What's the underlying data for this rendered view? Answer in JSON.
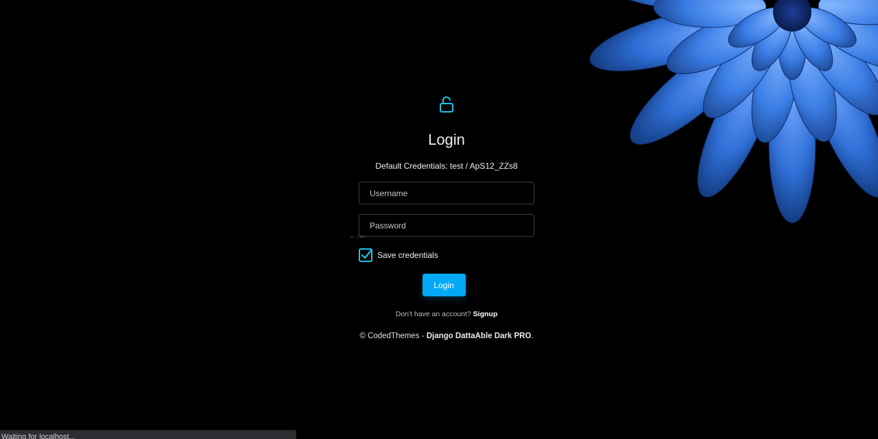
{
  "theme": {
    "accent": "#04a9f5",
    "icon_color": "#1dc4e9",
    "background": "#000000",
    "flower_color": "#3a7be0"
  },
  "auth": {
    "lock_icon": "unlock-icon",
    "title": "Login",
    "credentials_note": "Default Credentials: test / ApS12_ZZs8",
    "username_placeholder": "Username",
    "password_placeholder": "Password",
    "tiny_note": "ex. C9ET...",
    "save_label": "Save credentials",
    "save_checked": true,
    "login_button": "Login",
    "no_account_text": "Don't have an account?",
    "signup_link": "Signup"
  },
  "footer": {
    "copyright_prefix": "© CodedThemes - ",
    "product": "Django DattaAble Dark PRO",
    "suffix": "."
  },
  "browser_status": {
    "text": "Waiting for localhost..."
  }
}
